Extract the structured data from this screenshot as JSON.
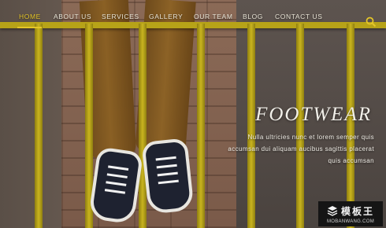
{
  "nav": {
    "items": [
      {
        "label": "HOME",
        "active": true
      },
      {
        "label": "ABOUT US",
        "active": false
      },
      {
        "label": "SERVICES",
        "active": false
      },
      {
        "label": "GALLERY",
        "active": false
      },
      {
        "label": "OUR TEAM",
        "active": false
      },
      {
        "label": "BLOG",
        "active": false
      },
      {
        "label": "CONTACT US",
        "active": false
      }
    ],
    "search_icon": "search-icon"
  },
  "hero": {
    "title": "FOOTWEAR",
    "lines": [
      "Nulla ultricies nunc et lorem semper quis",
      "accumsan dui aliquam aucibus sagittis placerat",
      "quis accumsan"
    ]
  },
  "watermark": {
    "name": "模板王",
    "url": "MOBANWANG.COM"
  },
  "colors": {
    "accent": "#e5c628",
    "rail": "#b7a318"
  }
}
